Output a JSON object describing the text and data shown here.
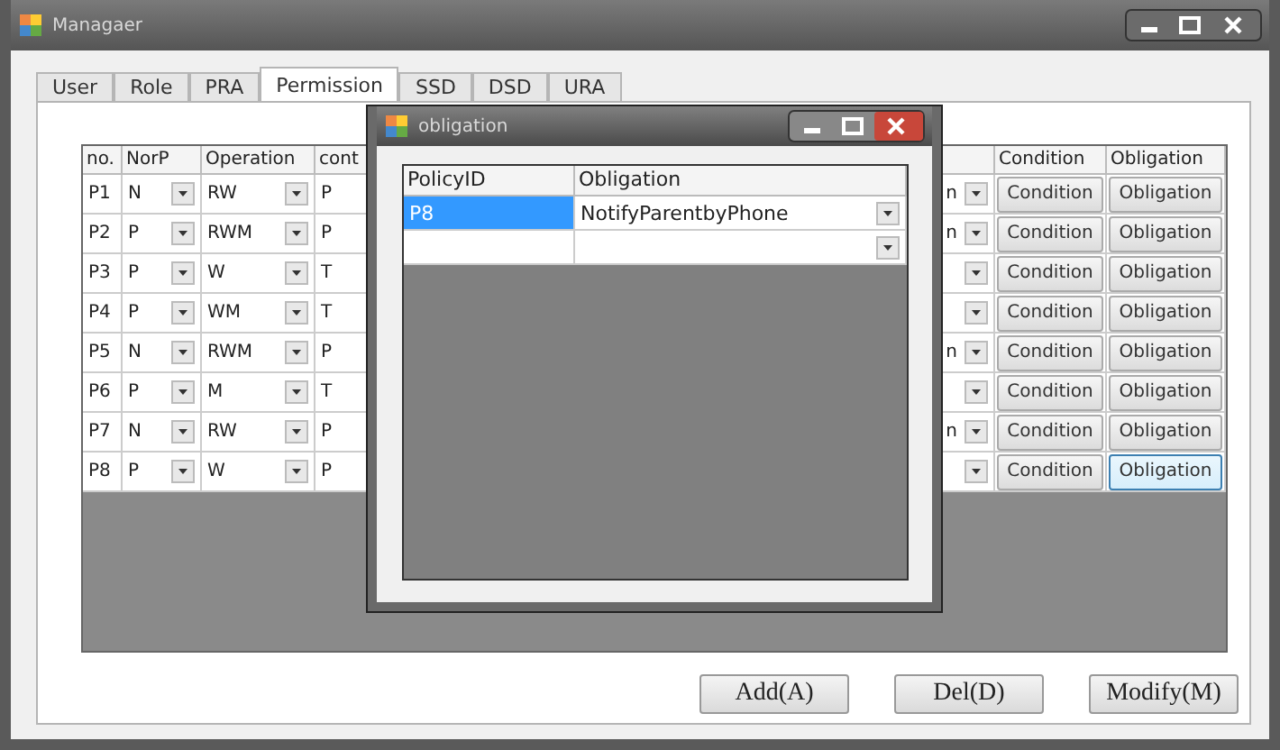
{
  "window": {
    "title": "Managaer"
  },
  "tabs": [
    {
      "label": "User",
      "selected": false
    },
    {
      "label": "Role",
      "selected": false
    },
    {
      "label": "PRA",
      "selected": false
    },
    {
      "label": "Permission",
      "selected": true
    },
    {
      "label": "SSD",
      "selected": false
    },
    {
      "label": "DSD",
      "selected": false
    },
    {
      "label": "URA",
      "selected": false
    }
  ],
  "grid": {
    "columns": [
      "no.",
      "NorP",
      "Operation",
      "cont",
      "Condition",
      "Obligation"
    ],
    "rows": [
      {
        "no": "P1",
        "norp": "N",
        "operation": "RW",
        "column_4": "P",
        "column_5": "n",
        "condition": "Condition",
        "obligation": "Obligation",
        "focused": false
      },
      {
        "no": "P2",
        "norp": "P",
        "operation": "RWM",
        "column_4": "P",
        "column_5": "n",
        "condition": "Condition",
        "obligation": "Obligation",
        "focused": false
      },
      {
        "no": "P3",
        "norp": "P",
        "operation": "W",
        "column_4": "T",
        "condition": "Condition",
        "obligation": "Obligation",
        "focused": false
      },
      {
        "no": "P4",
        "norp": "P",
        "operation": "WM",
        "column_4": "T",
        "condition": "Condition",
        "obligation": "Obligation",
        "focused": false
      },
      {
        "no": "P5",
        "norp": "N",
        "operation": "RWM",
        "column_4": "P",
        "column_5": "n",
        "condition": "Condition",
        "obligation": "Obligation",
        "focused": false
      },
      {
        "no": "P6",
        "norp": "P",
        "operation": "M",
        "column_4": "T",
        "condition": "Condition",
        "obligation": "Obligation",
        "focused": false
      },
      {
        "no": "P7",
        "norp": "N",
        "operation": "RW",
        "column_4": "P",
        "column_5": "n",
        "condition": "Condition",
        "obligation": "Obligation",
        "focused": false
      },
      {
        "no": "P8",
        "norp": "P",
        "operation": "W",
        "column_4": "P",
        "condition": "Condition",
        "obligation": "Obligation",
        "focused": true
      }
    ]
  },
  "dialog": {
    "title": "obligation",
    "columns": [
      "PolicyID",
      "Obligation"
    ],
    "rows": [
      {
        "policy_id": "P8",
        "obligation": "NotifyParentbyPhone",
        "selected": true
      },
      {
        "selected": false
      }
    ]
  },
  "buttons": [
    "Add(A)",
    "Del(D)",
    "Modify(M)"
  ]
}
